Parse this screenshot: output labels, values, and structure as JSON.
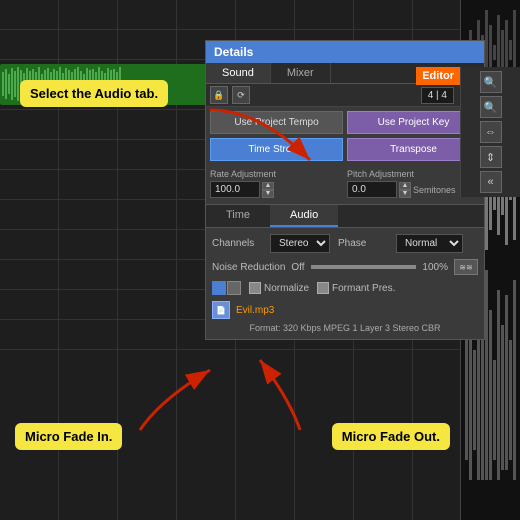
{
  "app": {
    "title": "Details"
  },
  "tabs": {
    "sound": "Sound",
    "mixer": "Mixer"
  },
  "toolbar": {
    "time_display": "4 | 4",
    "play_icon": "▶",
    "loop_icon": "⟳",
    "lock_icon": "🔒"
  },
  "stretch": {
    "use_project_tempo": "Use Project Tempo",
    "use_project_key": "Use Project Key",
    "time_stretch": "Time Stretch",
    "transpose": "Transpose"
  },
  "rate": {
    "label": "Rate Adjustment",
    "value": "100.0"
  },
  "pitch": {
    "label": "Pitch Adjustment",
    "value": "0.0",
    "unit": "Semitones"
  },
  "sections": {
    "time": "Time",
    "audio": "Audio"
  },
  "audio": {
    "channels_label": "Channels",
    "channels_value": "Stereo",
    "phase_label": "Phase",
    "phase_value": "Normal",
    "noise_label": "Noise Reduction",
    "noise_off": "Off",
    "noise_max": "100%",
    "normalize_label": "Normalize",
    "formant_label": "Formant Pres."
  },
  "file": {
    "name": "Evil.mp3",
    "format": "Format: 320 Kbps MPEG 1 Layer 3 Stereo CBR"
  },
  "annotations": {
    "select_audio": "Select the Audio tab.",
    "micro_fade_in": "Micro Fade In.",
    "micro_fade_out": "Micro Fade Out."
  },
  "editor": {
    "label": "Editor"
  }
}
